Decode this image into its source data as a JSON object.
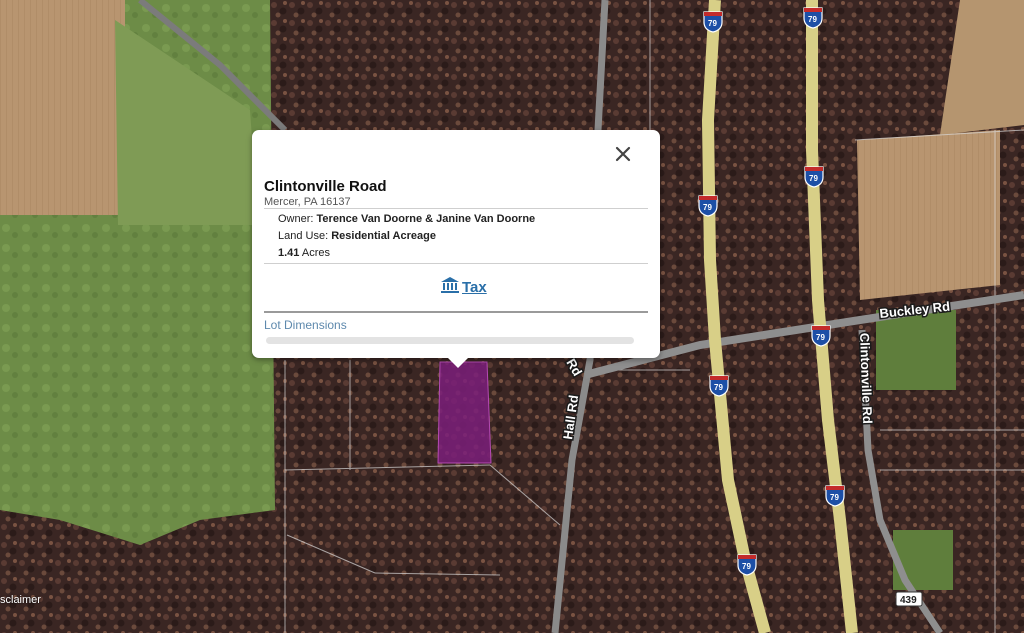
{
  "map": {
    "road_labels": {
      "buckley": "Buckley Rd",
      "clintonville": "Clintonville Rd",
      "hall": "Hall Rd",
      "hall_partial": "Rd"
    },
    "interstate_shield_number": "79",
    "route_shield_number": "439",
    "disclaimer": "sclaimer",
    "colors": {
      "parcel_fill": "#7b1f7a",
      "interstate": "#d8cf87",
      "forest": "#3b2724"
    }
  },
  "popup": {
    "title": "Clintonville Road",
    "subtitle": "Mercer, PA 16137",
    "owner_label": "Owner:",
    "owner_value": "Terence Van Doorne & Janine Van Doorne",
    "land_use_label": "Land Use:",
    "land_use_value": "Residential Acreage",
    "acres_value": "1.41",
    "acres_unit": "Acres",
    "tax_label": "Tax",
    "tax_icon": "bank-icon",
    "lot_dimensions_label": "Lot Dimensions",
    "close_icon": "close-icon"
  }
}
